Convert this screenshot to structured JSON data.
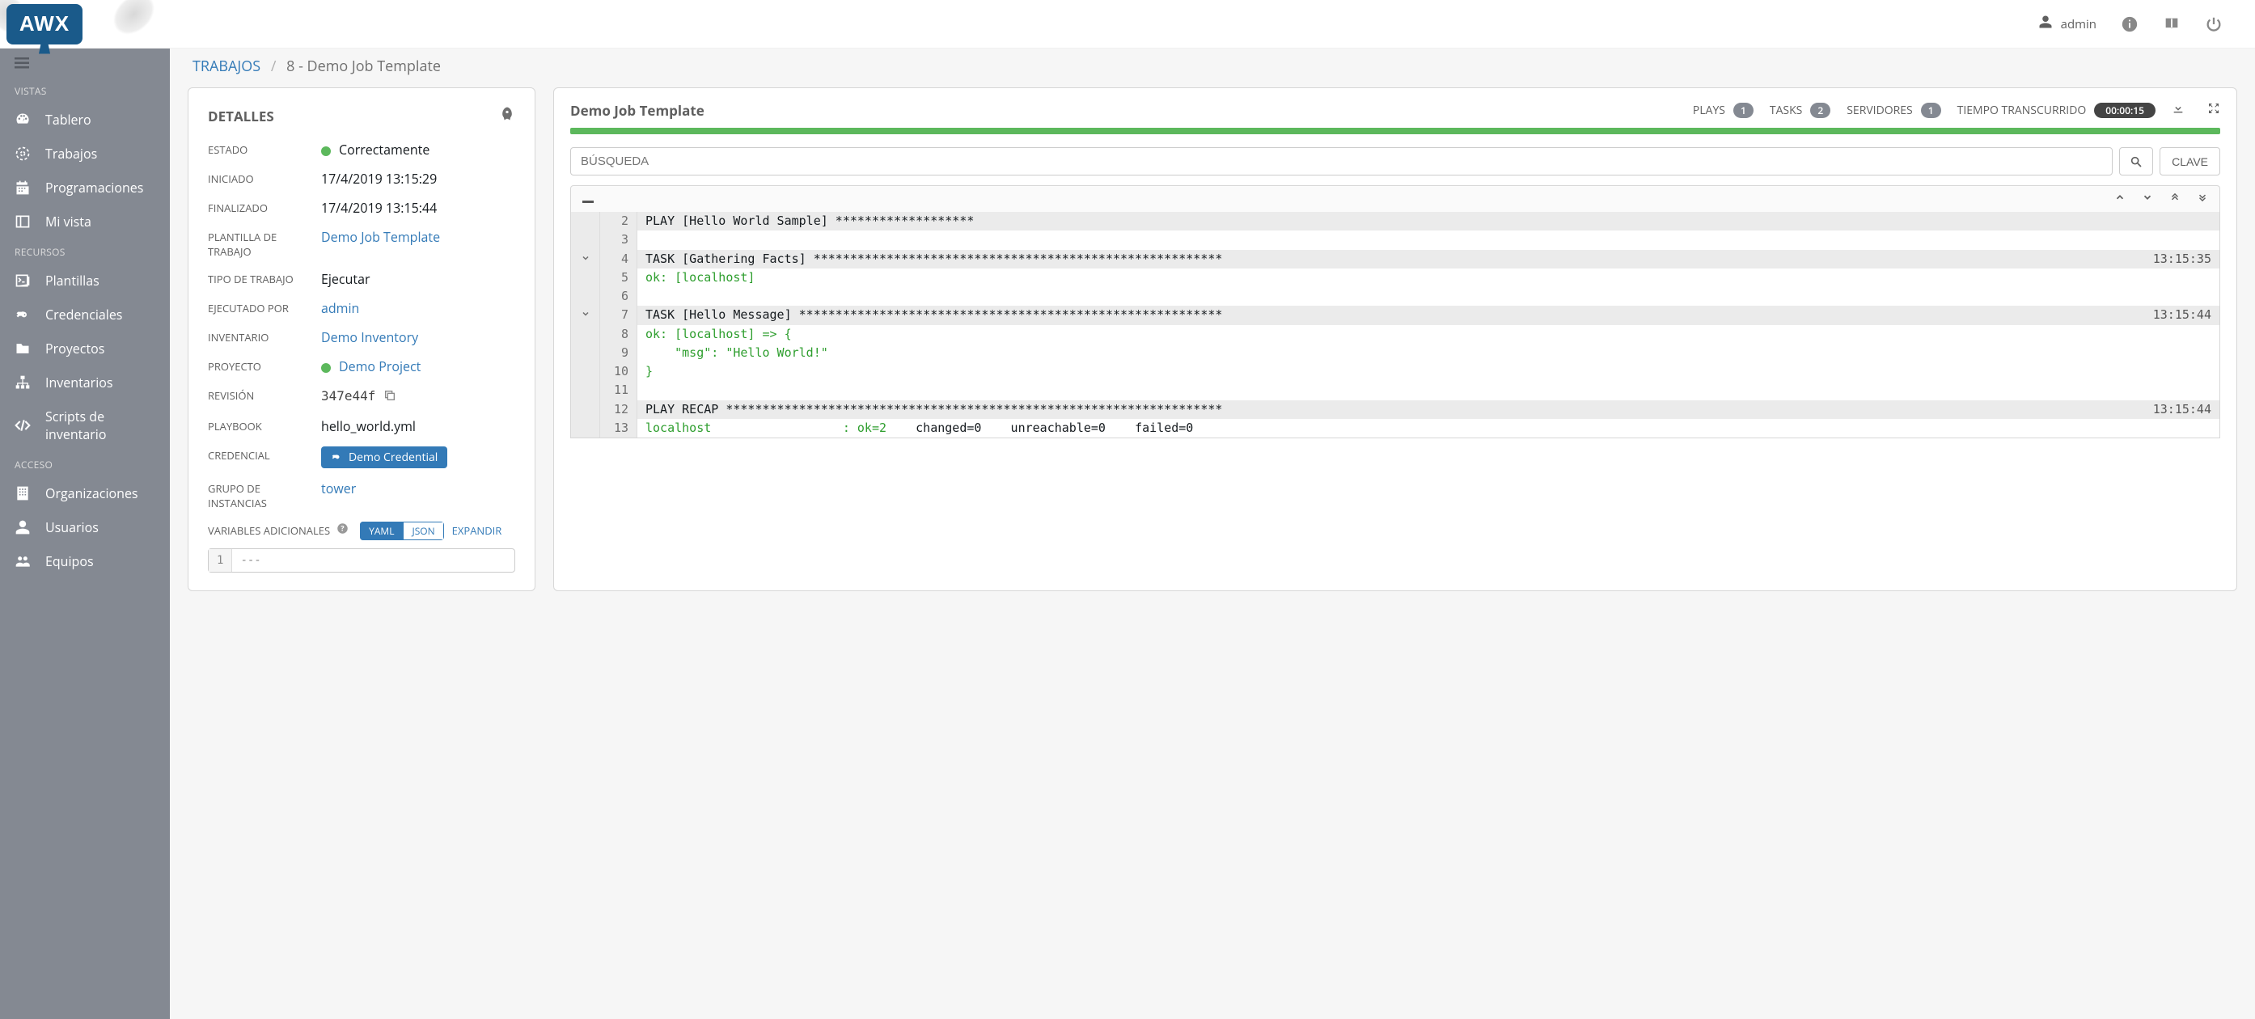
{
  "app": {
    "brand": "AWX"
  },
  "topbar": {
    "username": "admin"
  },
  "sidebar": {
    "sections": {
      "views": "VISTAS",
      "resources": "RECURSOS",
      "access": "ACCESO"
    },
    "items": {
      "dashboard": "Tablero",
      "jobs": "Trabajos",
      "schedules": "Programaciones",
      "myview": "Mi vista",
      "templates": "Plantillas",
      "credentials": "Credenciales",
      "projects": "Proyectos",
      "inventories": "Inventarios",
      "invscripts": "Scripts de inventario",
      "orgs": "Organizaciones",
      "users": "Usuarios",
      "teams": "Equipos"
    }
  },
  "breadcrumb": {
    "root": "TRABAJOS",
    "current": "8 - Demo Job Template"
  },
  "details": {
    "title": "DETALLES",
    "labels": {
      "status": "ESTADO",
      "started": "INICIADO",
      "finished": "FINALIZADO",
      "jobtemplate": "PLANTILLA DE TRABAJO",
      "jobtype": "TIPO DE TRABAJO",
      "launchedby": "EJECUTADO POR",
      "inventory": "INVENTARIO",
      "project": "PROYECTO",
      "revision": "REVISIÓN",
      "playbook": "PLAYBOOK",
      "credential": "CREDENCIAL",
      "instancegroup": "GRUPO DE INSTANCIAS",
      "extravars": "VARIABLES ADICIONALES"
    },
    "values": {
      "status": "Correctamente",
      "started": "17/4/2019 13:15:29",
      "finished": "17/4/2019 13:15:44",
      "jobtemplate": "Demo Job Template",
      "jobtype": "Ejecutar",
      "launchedby": "admin",
      "inventory": "Demo Inventory",
      "project": "Demo Project",
      "revision": "347e44f",
      "playbook": "hello_world.yml",
      "credential": "Demo Credential",
      "instancegroup": "tower"
    },
    "extravars": {
      "yaml_btn": "YAML",
      "json_btn": "JSON",
      "expand": "EXPANDIR",
      "gutter": "1",
      "content": "---"
    }
  },
  "output": {
    "title": "Demo Job Template",
    "stats": {
      "plays_label": "PLAYS",
      "plays": "1",
      "tasks_label": "TASKS",
      "tasks": "2",
      "hosts_label": "SERVIDORES",
      "hosts": "1",
      "elapsed_label": "TIEMPO TRANSCURRIDO",
      "elapsed": "00:00:15"
    },
    "search_placeholder": "BÚSQUEDA",
    "key_btn": "CLAVE",
    "log": [
      {
        "line": "2",
        "content": "PLAY [Hello World Sample] *******************",
        "header": true
      },
      {
        "line": "3",
        "content": "",
        "header": false
      },
      {
        "line": "4",
        "content": "TASK [Gathering Facts] ********************************************************",
        "time": "13:15:35",
        "header": true,
        "toggle": true
      },
      {
        "line": "5",
        "content": "ok: [localhost]",
        "ok": true
      },
      {
        "line": "6",
        "content": ""
      },
      {
        "line": "7",
        "content": "TASK [Hello Message] **********************************************************",
        "time": "13:15:44",
        "header": true,
        "toggle": true
      },
      {
        "line": "8",
        "content": "ok: [localhost] => {",
        "ok": true
      },
      {
        "line": "9",
        "content": "    \"msg\": \"Hello World!\"",
        "ok": true
      },
      {
        "line": "10",
        "content": "}",
        "ok": true
      },
      {
        "line": "11",
        "content": ""
      },
      {
        "line": "12",
        "content": "PLAY RECAP ********************************************************************",
        "time": "13:15:44",
        "header": true
      },
      {
        "line": "13",
        "content_pre": "localhost                  : ",
        "content_ok": "ok=2",
        "content_post": "    changed=0    unreachable=0    failed=0",
        "recap": true
      }
    ]
  }
}
